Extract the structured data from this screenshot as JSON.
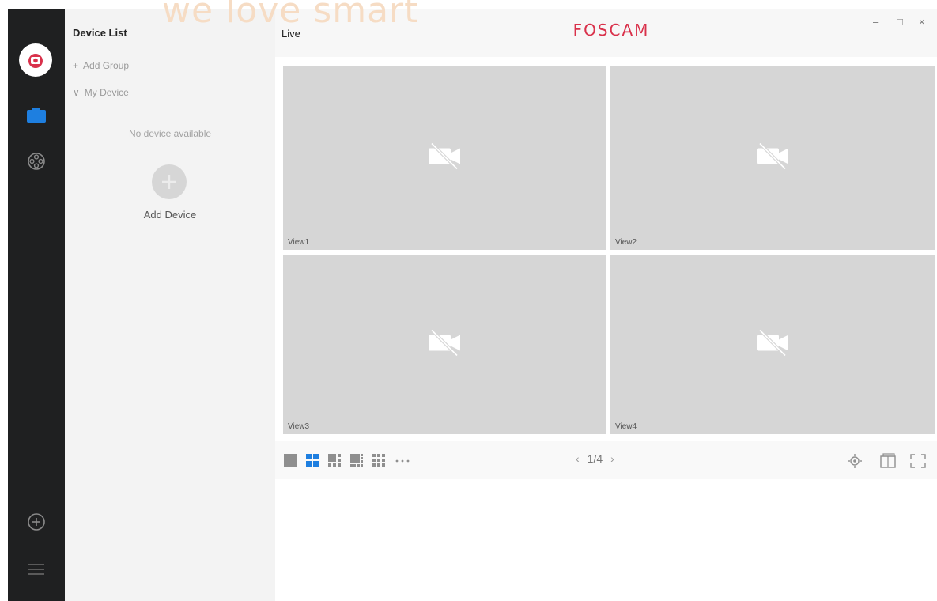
{
  "watermark": "we love smart",
  "rail": {
    "icons": [
      "foscam-logo-icon",
      "live-view-icon",
      "playback-icon",
      "add-icon",
      "menu-icon"
    ]
  },
  "device_panel": {
    "title": "Device List",
    "add_group": "Add Group",
    "my_device": "My Device",
    "empty_text": "No device available",
    "add_device": "Add Device"
  },
  "main": {
    "title": "Live",
    "brand": "FOSCAM",
    "brand_sub": "",
    "views": [
      "View1",
      "View2",
      "View3",
      "View4"
    ],
    "pager": "1/4",
    "window_controls": {
      "minimize": "–",
      "maximize": "□",
      "close": "×"
    }
  },
  "colors": {
    "accent": "#1e7fe0",
    "brand": "#d9314b",
    "rail_bg": "#1f2021",
    "cell_bg": "#d6d6d6"
  }
}
